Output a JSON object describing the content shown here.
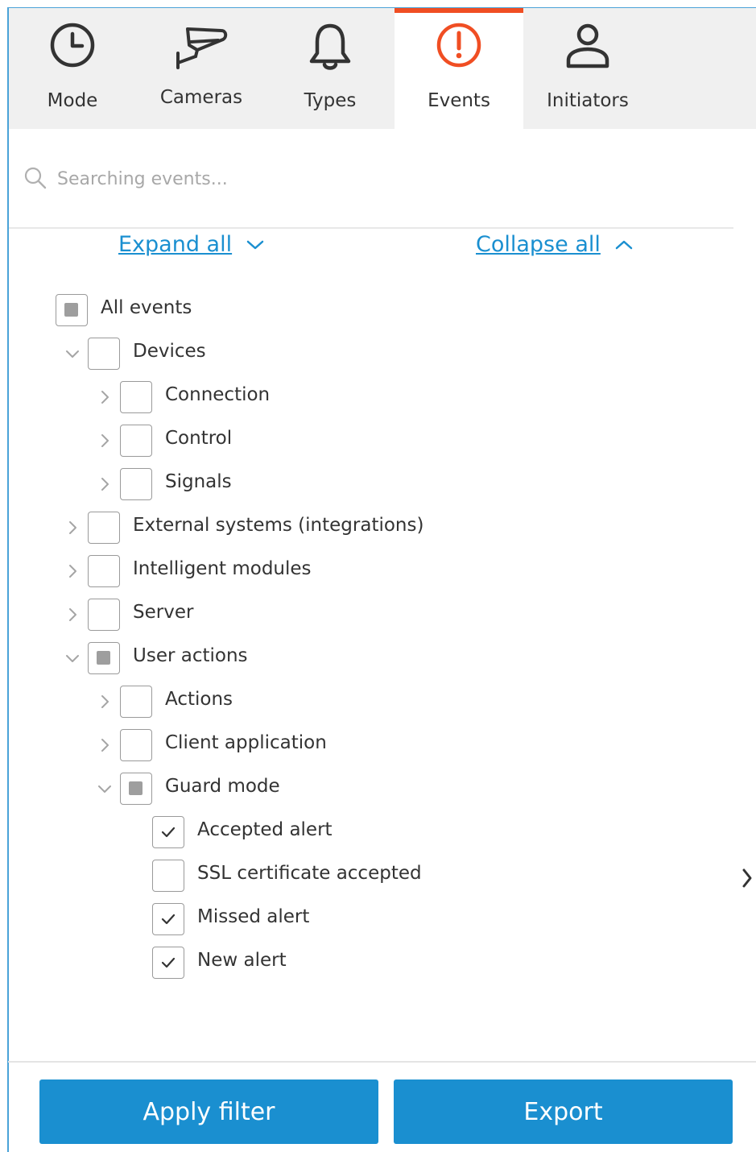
{
  "tabs": [
    {
      "label": "Mode",
      "icon": "clock-icon"
    },
    {
      "label": "Cameras",
      "icon": "camera-icon"
    },
    {
      "label": "Types",
      "icon": "bell-icon"
    },
    {
      "label": "Events",
      "icon": "alert-icon",
      "active": true
    },
    {
      "label": "Initiators",
      "icon": "user-icon"
    }
  ],
  "search": {
    "placeholder": "Searching events..."
  },
  "links": {
    "expand_all": "Expand all",
    "collapse_all": "Collapse all"
  },
  "tree": [
    {
      "label": "All events",
      "state": "partial"
    },
    {
      "label": "Devices",
      "state": "unchecked",
      "expanded": true
    },
    {
      "label": "Connection",
      "state": "unchecked",
      "expanded": false
    },
    {
      "label": "Control",
      "state": "unchecked",
      "expanded": false
    },
    {
      "label": "Signals",
      "state": "unchecked",
      "expanded": false
    },
    {
      "label": "External systems (integrations)",
      "state": "unchecked",
      "expanded": false
    },
    {
      "label": "Intelligent modules",
      "state": "unchecked",
      "expanded": false
    },
    {
      "label": "Server",
      "state": "unchecked",
      "expanded": false
    },
    {
      "label": "User actions",
      "state": "partial",
      "expanded": true
    },
    {
      "label": "Actions",
      "state": "unchecked",
      "expanded": false
    },
    {
      "label": "Client application",
      "state": "unchecked",
      "expanded": false
    },
    {
      "label": "Guard mode",
      "state": "partial",
      "expanded": true
    },
    {
      "label": "Accepted alert",
      "state": "checked"
    },
    {
      "label": "SSL certificate accepted",
      "state": "unchecked"
    },
    {
      "label": "Missed alert",
      "state": "checked"
    },
    {
      "label": "New alert",
      "state": "checked"
    }
  ],
  "buttons": {
    "apply": "Apply filter",
    "export": "Export"
  },
  "colors": {
    "accent": "#1a8fd0",
    "active_tab": "#f04e23",
    "tab_bg": "#f0f0f0"
  }
}
